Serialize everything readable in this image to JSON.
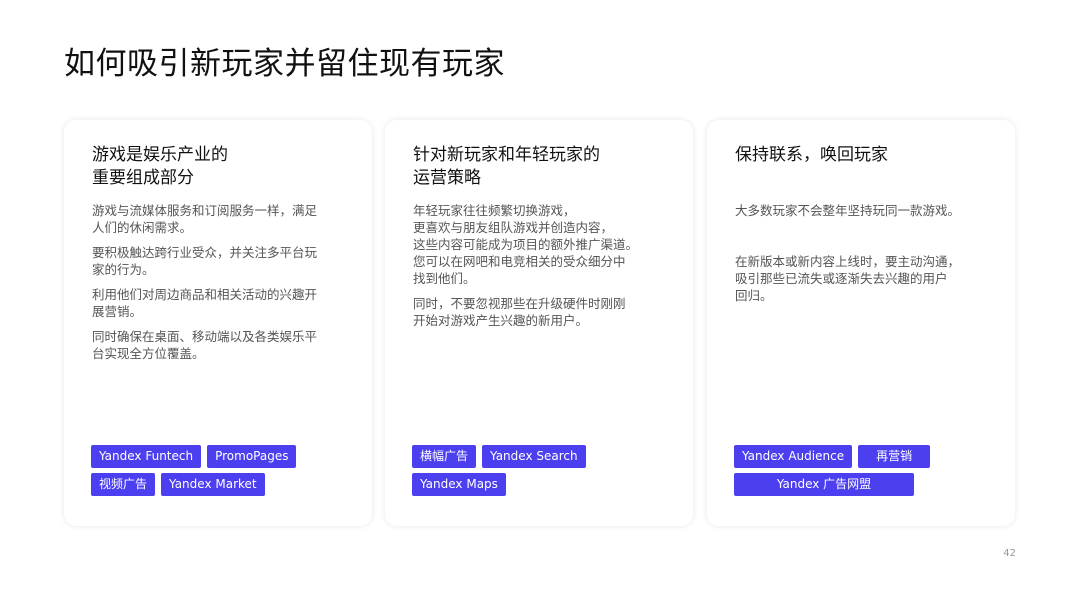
{
  "slide": {
    "title": "如何吸引新玩家并留住现有玩家",
    "page_number": "42"
  },
  "cards": [
    {
      "heading_lines": [
        "游戏是娱乐产业的",
        "重要组成部分"
      ],
      "paragraphs": [
        [
          "游戏与流媒体服务和订阅服务一样，满足",
          "人们的休闲需求。"
        ],
        [
          "要积极触达跨行业受众，并关注多平台玩",
          "家的行为。"
        ],
        [
          "利用他们对周边商品和相关活动的兴趣开",
          "展营销。"
        ],
        [
          "同时确保在桌面、移动端以及各类娱乐平",
          "台实现全方位覆盖。"
        ]
      ],
      "tags": [
        "Yandex Funtech",
        "PromoPages",
        "视频广告",
        "Yandex Market"
      ]
    },
    {
      "heading_lines": [
        "针对新玩家和年轻玩家的",
        "运营策略"
      ],
      "paragraphs": [
        [
          "年轻玩家往往频繁切换游戏，",
          "更喜欢与朋友组队游戏并创造内容，",
          "这些内容可能成为项目的额外推广渠道。",
          "您可以在网吧和电竞相关的受众细分中",
          "找到他们。"
        ],
        [
          "同时，不要忽视那些在升级硬件时刚刚",
          "开始对游戏产生兴趣的新用户。"
        ]
      ],
      "tags": [
        "横幅广告",
        "Yandex Search",
        "Yandex Maps"
      ]
    },
    {
      "heading_lines": [
        "保持联系，唤回玩家"
      ],
      "paragraphs": [
        [
          "大多数玩家不会整年坚持玩同一款游戏。"
        ],
        [
          "在新版本或新内容上线时，要主动沟通，",
          "吸引那些已流失或逐渐失去兴趣的用户",
          "回归。"
        ]
      ],
      "tags": [
        "Yandex Audience",
        "再营销",
        "Yandex 广告网盟"
      ]
    }
  ],
  "colors": {
    "tag_background": "#4b3ff0",
    "tag_text": "#ffffff"
  }
}
